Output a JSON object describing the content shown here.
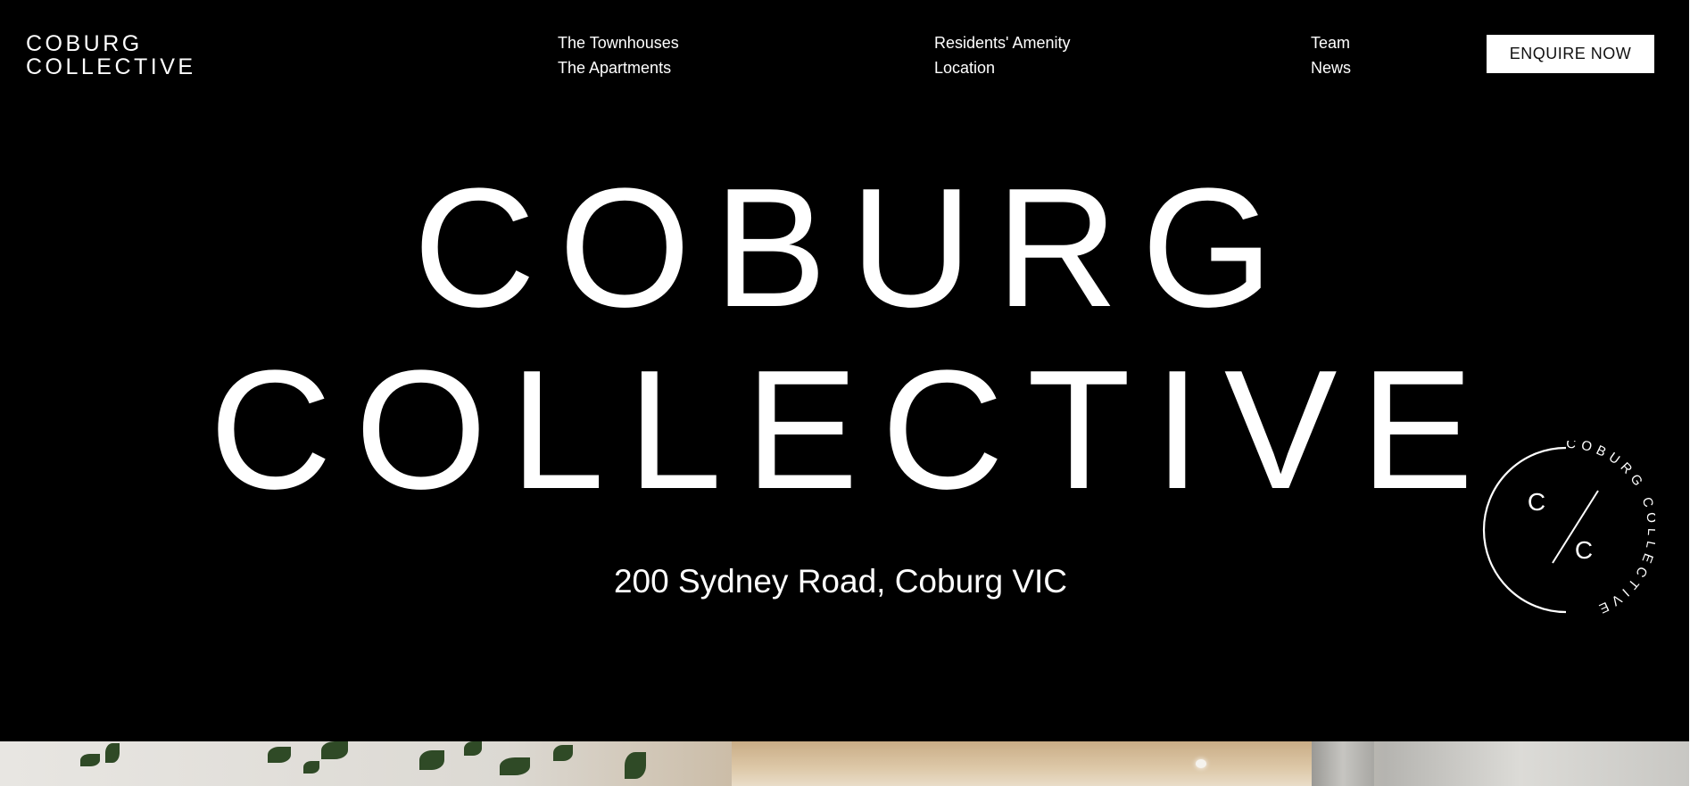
{
  "header": {
    "logo_line1": "COBURG",
    "logo_line2": "COLLECTIVE",
    "nav_columns": [
      [
        "The Townhouses",
        "The Apartments"
      ],
      [
        "Residents' Amenity",
        "Location"
      ],
      [
        "Team",
        "News"
      ]
    ],
    "enquire_label": "ENQUIRE NOW"
  },
  "hero": {
    "title_line1": "COBURG",
    "title_line2": "COLLECTIVE",
    "address": "200 Sydney Road, Coburg VIC"
  },
  "badge": {
    "letter_top": "C",
    "letter_bottom": "C",
    "ring_text": "COBURG COLLECTIVE"
  },
  "colors": {
    "background": "#000000",
    "text": "#ffffff",
    "button_bg": "#ffffff",
    "button_text": "#111111"
  }
}
